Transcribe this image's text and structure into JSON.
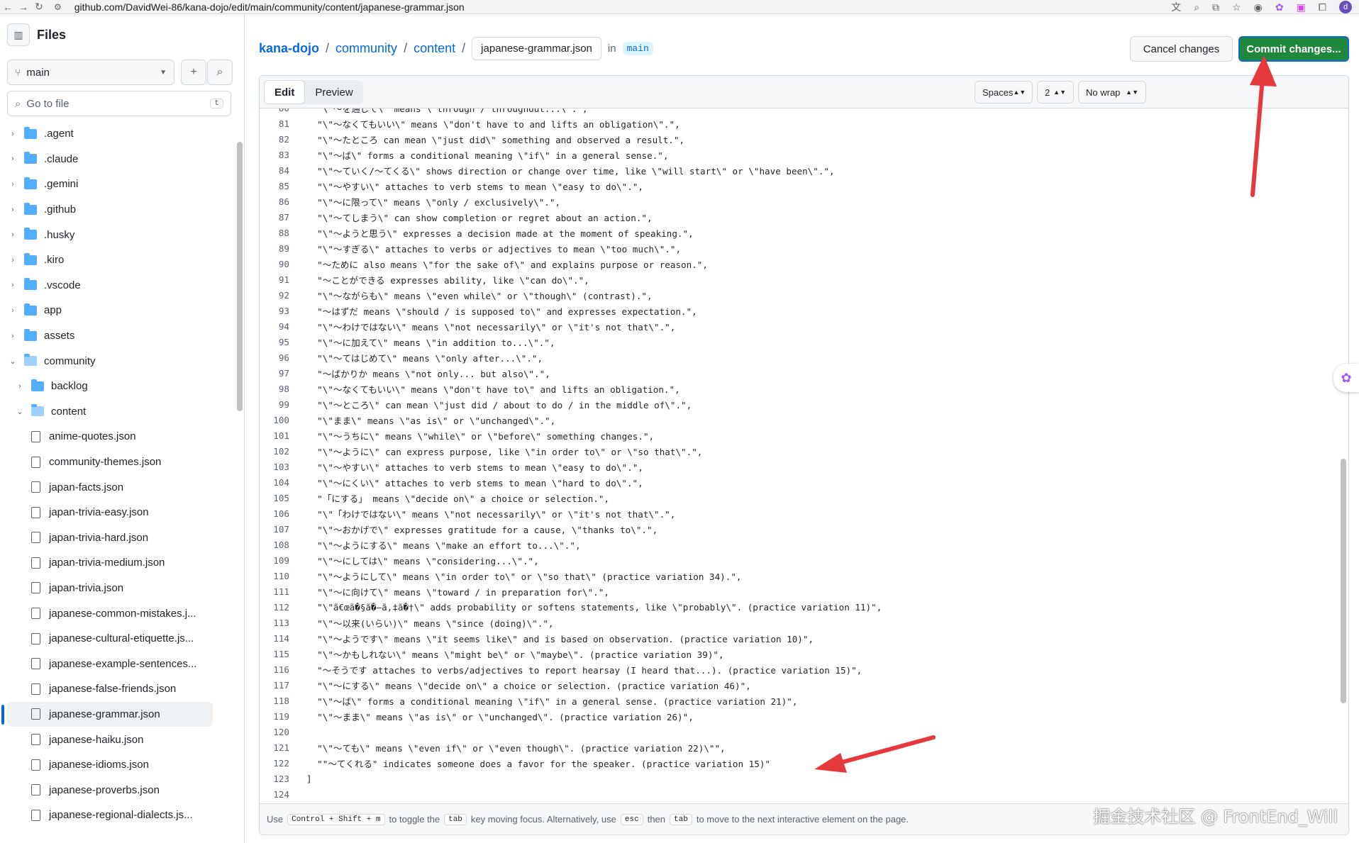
{
  "browser": {
    "url": "github.com/DavidWei-86/kana-dojo/edit/main/community/content/japanese-grammar.json",
    "profile_initial": "d"
  },
  "sidebar": {
    "title": "Files",
    "branch": "main",
    "goto_placeholder": "Go to file",
    "goto_shortcut": "t",
    "tree": [
      {
        "type": "folder",
        "label": ".agent",
        "depth": 0,
        "open": false
      },
      {
        "type": "folder",
        "label": ".claude",
        "depth": 0,
        "open": false
      },
      {
        "type": "folder",
        "label": ".gemini",
        "depth": 0,
        "open": false
      },
      {
        "type": "folder",
        "label": ".github",
        "depth": 0,
        "open": false
      },
      {
        "type": "folder",
        "label": ".husky",
        "depth": 0,
        "open": false
      },
      {
        "type": "folder",
        "label": ".kiro",
        "depth": 0,
        "open": false
      },
      {
        "type": "folder",
        "label": ".vscode",
        "depth": 0,
        "open": false
      },
      {
        "type": "folder",
        "label": "app",
        "depth": 0,
        "open": false
      },
      {
        "type": "folder",
        "label": "assets",
        "depth": 0,
        "open": false
      },
      {
        "type": "folder",
        "label": "community",
        "depth": 0,
        "open": true
      },
      {
        "type": "folder",
        "label": "backlog",
        "depth": 1,
        "open": false
      },
      {
        "type": "folder",
        "label": "content",
        "depth": 1,
        "open": true
      },
      {
        "type": "file",
        "label": "anime-quotes.json",
        "depth": 2
      },
      {
        "type": "file",
        "label": "community-themes.json",
        "depth": 2
      },
      {
        "type": "file",
        "label": "japan-facts.json",
        "depth": 2
      },
      {
        "type": "file",
        "label": "japan-trivia-easy.json",
        "depth": 2
      },
      {
        "type": "file",
        "label": "japan-trivia-hard.json",
        "depth": 2
      },
      {
        "type": "file",
        "label": "japan-trivia-medium.json",
        "depth": 2
      },
      {
        "type": "file",
        "label": "japan-trivia.json",
        "depth": 2
      },
      {
        "type": "file",
        "label": "japanese-common-mistakes.j...",
        "depth": 2
      },
      {
        "type": "file",
        "label": "japanese-cultural-etiquette.js...",
        "depth": 2
      },
      {
        "type": "file",
        "label": "japanese-example-sentences...",
        "depth": 2
      },
      {
        "type": "file",
        "label": "japanese-false-friends.json",
        "depth": 2
      },
      {
        "type": "file",
        "label": "japanese-grammar.json",
        "depth": 2,
        "selected": true
      },
      {
        "type": "file",
        "label": "japanese-haiku.json",
        "depth": 2
      },
      {
        "type": "file",
        "label": "japanese-idioms.json",
        "depth": 2
      },
      {
        "type": "file",
        "label": "japanese-proverbs.json",
        "depth": 2
      },
      {
        "type": "file",
        "label": "japanese-regional-dialects.js...",
        "depth": 2
      }
    ]
  },
  "header": {
    "crumbs": [
      "kana-dojo",
      "community",
      "content"
    ],
    "filename": "japanese-grammar.json",
    "in_label": "in",
    "branch": "main",
    "cancel_label": "Cancel changes",
    "commit_label": "Commit changes..."
  },
  "editor": {
    "tab_edit": "Edit",
    "tab_preview": "Preview",
    "indent_mode": "Spaces",
    "indent_size": "2",
    "wrap_mode": "No wrap",
    "lines": [
      {
        "n": "80",
        "t": "  \"\\\"～を通じて\\\" means \\\"through / throughout...\\\".\","
      },
      {
        "n": "81",
        "t": "  \"\\\"～なくてもいい\\\" means \\\"don't have to and lifts an obligation\\\".\","
      },
      {
        "n": "82",
        "t": "  \"\\\"～たところ can mean \\\"just did\\\" something and observed a result.\","
      },
      {
        "n": "83",
        "t": "  \"\\\"～ば\\\" forms a conditional meaning \\\"if\\\" in a general sense.\","
      },
      {
        "n": "84",
        "t": "  \"\\\"～ていく/～てくる\\\" shows direction or change over time, like \\\"will start\\\" or \\\"have been\\\".\","
      },
      {
        "n": "85",
        "t": "  \"\\\"～やすい\\\" attaches to verb stems to mean \\\"easy to do\\\".\","
      },
      {
        "n": "86",
        "t": "  \"\\\"～に限って\\\" means \\\"only / exclusively\\\".\","
      },
      {
        "n": "87",
        "t": "  \"\\\"～てしまう\\\" can show completion or regret about an action.\","
      },
      {
        "n": "88",
        "t": "  \"\\\"～ようと思う\\\" expresses a decision made at the moment of speaking.\","
      },
      {
        "n": "89",
        "t": "  \"\\\"～すぎる\\\" attaches to verbs or adjectives to mean \\\"too much\\\".\","
      },
      {
        "n": "90",
        "t": "  \"～ために also means \\\"for the sake of\\\" and explains purpose or reason.\","
      },
      {
        "n": "91",
        "t": "  \"～ことができる expresses ability, like \\\"can do\\\".\","
      },
      {
        "n": "92",
        "t": "  \"\\\"～ながらも\\\" means \\\"even while\\\" or \\\"though\\\" (contrast).\","
      },
      {
        "n": "93",
        "t": "  \"～はずだ means \\\"should / is supposed to\\\" and expresses expectation.\","
      },
      {
        "n": "94",
        "t": "  \"\\\"～わけではない\\\" means \\\"not necessarily\\\" or \\\"it's not that\\\".\","
      },
      {
        "n": "95",
        "t": "  \"\\\"～に加えて\\\" means \\\"in addition to...\\\".\","
      },
      {
        "n": "96",
        "t": "  \"\\\"～てはじめて\\\" means \\\"only after...\\\".\","
      },
      {
        "n": "97",
        "t": "  \"～ばかりか means \\\"not only... but also\\\".\","
      },
      {
        "n": "98",
        "t": "  \"\\\"～なくてもいい\\\" means \\\"don't have to\\\" and lifts an obligation.\","
      },
      {
        "n": "99",
        "t": "  \"\\\"～ところ\\\" can mean \\\"just did / about to do / in the middle of\\\".\","
      },
      {
        "n": "100",
        "t": "  \"\\\"まま\\\" means \\\"as is\\\" or \\\"unchanged\\\".\","
      },
      {
        "n": "101",
        "t": "  \"\\\"～うちに\\\" means \\\"while\\\" or \\\"before\\\" something changes.\","
      },
      {
        "n": "102",
        "t": "  \"\\\"～ように\\\" can express purpose, like \\\"in order to\\\" or \\\"so that\\\".\","
      },
      {
        "n": "103",
        "t": "  \"\\\"～やすい\\\" attaches to verb stems to mean \\\"easy to do\\\".\","
      },
      {
        "n": "104",
        "t": "  \"\\\"～にくい\\\" attaches to verb stems to mean \\\"hard to do\\\".\","
      },
      {
        "n": "105",
        "t": "  \"「にする」 means \\\"decide on\\\" a choice or selection.\","
      },
      {
        "n": "106",
        "t": "  \"\\\"「わけではない\\\" means \\\"not necessarily\\\" or \\\"it's not that\\\".\","
      },
      {
        "n": "107",
        "t": "  \"\\\"～おかげで\\\" expresses gratitude for a cause, \\\"thanks to\\\".\","
      },
      {
        "n": "108",
        "t": "  \"\\\"～ようにする\\\" means \\\"make an effort to...\\\".\","
      },
      {
        "n": "109",
        "t": "  \"\\\"～にしては\\\" means \\\"considering...\\\".\","
      },
      {
        "n": "110",
        "t": "  \"\\\"～ようにして\\\" means \\\"in order to\\\" or \\\"so that\\\" (practice variation 34).\","
      },
      {
        "n": "111",
        "t": "  \"\\\"～に向けて\\\" means \\\"toward / in preparation for\\\".\","
      },
      {
        "n": "112",
        "t": "  \"\\\"ã€œã�§ã�—ã‚‡ã�†\\\" adds probability or softens statements, like \\\"probably\\\". (practice variation 11)\","
      },
      {
        "n": "113",
        "t": "  \"\\\"～以来(いらい)\\\" means \\\"since (doing)\\\".\","
      },
      {
        "n": "114",
        "t": "  \"\\\"～ようです\\\" means \\\"it seems like\\\" and is based on observation. (practice variation 10)\","
      },
      {
        "n": "115",
        "t": "  \"\\\"～かもしれない\\\" means \\\"might be\\\" or \\\"maybe\\\". (practice variation 39)\","
      },
      {
        "n": "116",
        "t": "  \"～そうです attaches to verbs/adjectives to report hearsay (I heard that...). (practice variation 15)\","
      },
      {
        "n": "117",
        "t": "  \"\\\"～にする\\\" means \\\"decide on\\\" a choice or selection. (practice variation 46)\","
      },
      {
        "n": "118",
        "t": "  \"\\\"～ば\\\" forms a conditional meaning \\\"if\\\" in a general sense. (practice variation 21)\","
      },
      {
        "n": "119",
        "t": "  \"\\\"～まま\\\" means \\\"as is\\\" or \\\"unchanged\\\". (practice variation 26)\","
      },
      {
        "n": "120",
        "t": ""
      },
      {
        "n": "121",
        "t": "  \"\\\"～ても\\\" means \\\"even if\\\" or \\\"even though\\\". (practice variation 22)\\\"\","
      },
      {
        "n": "122",
        "t": "  \"\"～てくれる\" indicates someone does a favor for the speaker. (practice variation 15)\""
      },
      {
        "n": "123",
        "t": "]"
      },
      {
        "n": "124",
        "t": ""
      }
    ],
    "footer": {
      "use": "Use",
      "k1": "Control + Shift + m",
      "t1": "to toggle the",
      "k2": "tab",
      "t2": "key moving focus. Alternatively, use",
      "k3": "esc",
      "t3": "then",
      "k4": "tab",
      "t4": "to move to the next interactive element on the page."
    }
  },
  "watermark": "掘金技术社区 @ FrontEnd_Will",
  "colors": {
    "accent": "#0969da",
    "commit": "#1f883d",
    "arrow": "#e5393d"
  }
}
